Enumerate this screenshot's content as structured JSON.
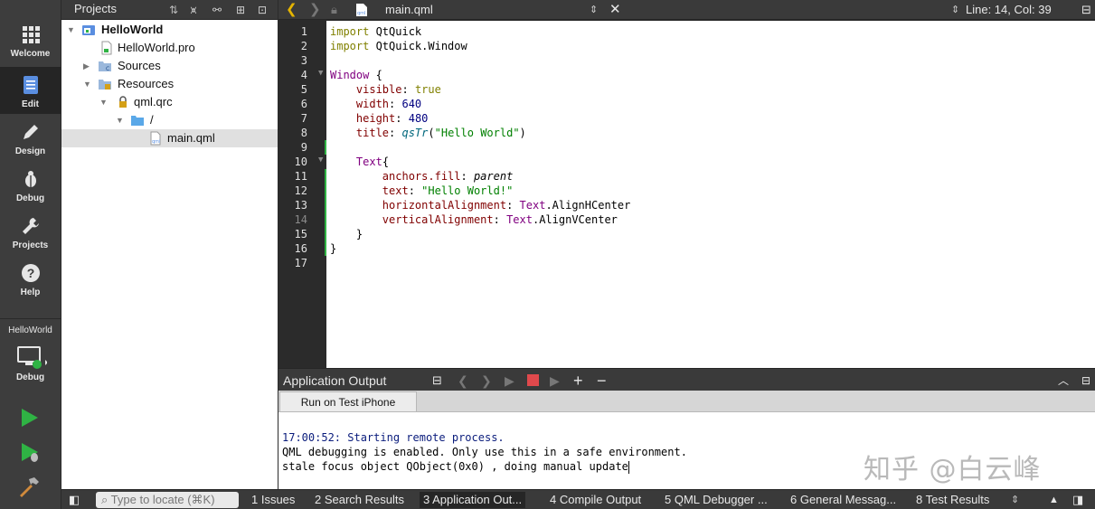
{
  "modebar": {
    "modes": [
      {
        "label": "Welcome",
        "icon": "grid-icon"
      },
      {
        "label": "Edit",
        "icon": "document-icon"
      },
      {
        "label": "Design",
        "icon": "pencil-icon"
      },
      {
        "label": "Debug",
        "icon": "bug-icon"
      },
      {
        "label": "Projects",
        "icon": "wrench-icon"
      },
      {
        "label": "Help",
        "icon": "question-icon"
      }
    ],
    "active": "Edit",
    "target_project": "HelloWorld",
    "target_mode": "Debug"
  },
  "projects": {
    "title": "Projects",
    "tree": [
      {
        "label": "HelloWorld",
        "expanded": true
      },
      {
        "label": "HelloWorld.pro"
      },
      {
        "label": "Sources",
        "expanded": false
      },
      {
        "label": "Resources",
        "expanded": true
      },
      {
        "label": "qml.qrc",
        "expanded": true
      },
      {
        "label": "/",
        "expanded": true
      },
      {
        "label": "main.qml",
        "selected": true
      }
    ]
  },
  "editor": {
    "file": "main.qml",
    "cursor": "Line: 14, Col: 39",
    "line_numbers": [
      "1",
      "2",
      "3",
      "4",
      "5",
      "6",
      "7",
      "8",
      "9",
      "10",
      "11",
      "12",
      "13",
      "14",
      "15",
      "16",
      "17"
    ]
  },
  "output": {
    "title": "Application Output",
    "tab": "Run on Test iPhone",
    "lines": [
      "17:00:52: Starting remote process.",
      "QML debugging is enabled. Only use this in a safe environment.",
      "stale focus object QObject(0x0) , doing manual update"
    ]
  },
  "statusbar": {
    "locator_placeholder": "Type to locate (⌘K)",
    "panes": [
      "1  Issues",
      "2  Search Results",
      "3  Application Out...",
      "4  Compile Output",
      "5  QML Debugger ...",
      "6  General Messag...",
      "8  Test Results"
    ]
  },
  "watermark": "知乎 @白云峰",
  "colors": {
    "accent_green": "#2fb344",
    "stop_red": "#e0494c",
    "arrow_yellow": "#e5b400"
  }
}
